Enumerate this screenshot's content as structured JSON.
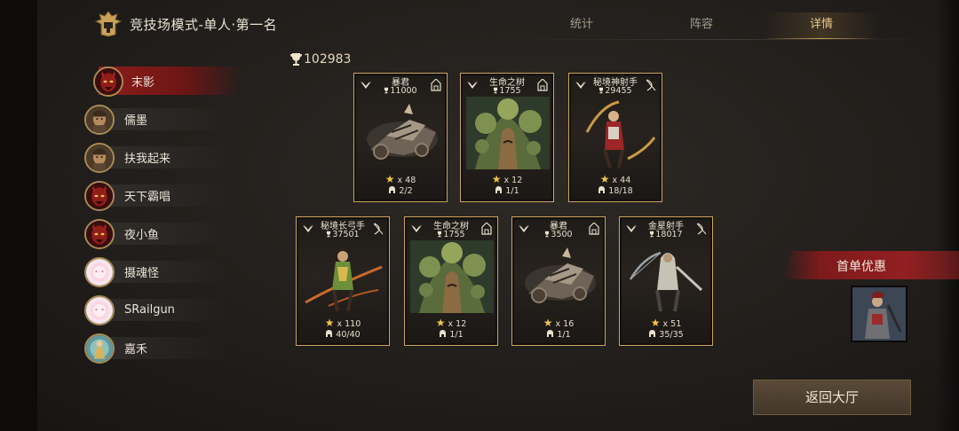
{
  "header": {
    "title": "竞技场模式-单人·第一名",
    "tabs": [
      {
        "label": "统计",
        "active": false
      },
      {
        "label": "阵容",
        "active": false
      },
      {
        "label": "详情",
        "active": true
      }
    ]
  },
  "players": [
    {
      "name": "末影",
      "active": true,
      "avatar": "red-demon"
    },
    {
      "name": "儒墨",
      "active": false,
      "avatar": "warrior"
    },
    {
      "name": "扶我起来",
      "active": false,
      "avatar": "warrior"
    },
    {
      "name": "天下霸唱",
      "active": false,
      "avatar": "red-demon"
    },
    {
      "name": "夜小鱼",
      "active": false,
      "avatar": "red-demon"
    },
    {
      "name": "摄魂怪",
      "active": false,
      "avatar": "pink-blob"
    },
    {
      "name": "SRailgun",
      "active": false,
      "avatar": "pink-blob"
    },
    {
      "name": "嘉禾",
      "active": false,
      "avatar": "archer"
    }
  ],
  "score": "102983",
  "units": [
    {
      "name": "暴君",
      "power": "11000",
      "stars": "x 48",
      "count": "2/2",
      "art": "siege"
    },
    {
      "name": "生命之树",
      "power": "1755",
      "stars": "x 12",
      "count": "1/1",
      "art": "tree"
    },
    {
      "name": "秘境神射手",
      "power": "29455",
      "stars": "x 44",
      "count": "18/18",
      "art": "archer-red"
    },
    {
      "name": "秘境长弓手",
      "power": "37501",
      "stars": "x 110",
      "count": "40/40",
      "art": "archer-green"
    },
    {
      "name": "生命之树",
      "power": "1755",
      "stars": "x 12",
      "count": "1/1",
      "art": "tree"
    },
    {
      "name": "暴君",
      "power": "3500",
      "stars": "x 16",
      "count": "1/1",
      "art": "siege"
    },
    {
      "name": "金星射手",
      "power": "18017",
      "stars": "x 51",
      "count": "35/35",
      "art": "archer-hood"
    }
  ],
  "promo": {
    "label": "首单优惠"
  },
  "back_button": {
    "label": "返回大厅"
  },
  "colors": {
    "accent_gold": "#c9a55c",
    "promo_red": "#931f21",
    "active_row_red": "#8e1c1b"
  }
}
